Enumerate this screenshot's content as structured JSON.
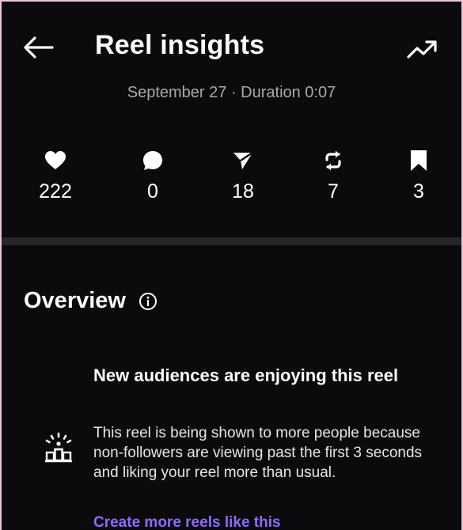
{
  "colors": {
    "frame": "#e8c6de",
    "background": "#0b0b0d",
    "link": "#8f69ff"
  },
  "header": {
    "back_icon": "arrow-left-icon",
    "title": "Reel insights",
    "trend_icon": "trending-up-icon",
    "subtitle": "September 27 · Duration 0:07"
  },
  "stats": [
    {
      "icon": "heart-icon",
      "value": "222"
    },
    {
      "icon": "comment-icon",
      "value": "0"
    },
    {
      "icon": "send-icon",
      "value": "18"
    },
    {
      "icon": "repost-icon",
      "value": "7"
    },
    {
      "icon": "bookmark-icon",
      "value": "3"
    }
  ],
  "overview": {
    "title": "Overview",
    "info_icon": "info-icon",
    "card": {
      "icon": "audience-icon",
      "title": "New audiences are enjoying this reel",
      "body": "This reel is being shown to more people because non-followers are viewing past the first 3 seconds and liking your reel more than usual.",
      "link": "Create more reels like this"
    }
  }
}
